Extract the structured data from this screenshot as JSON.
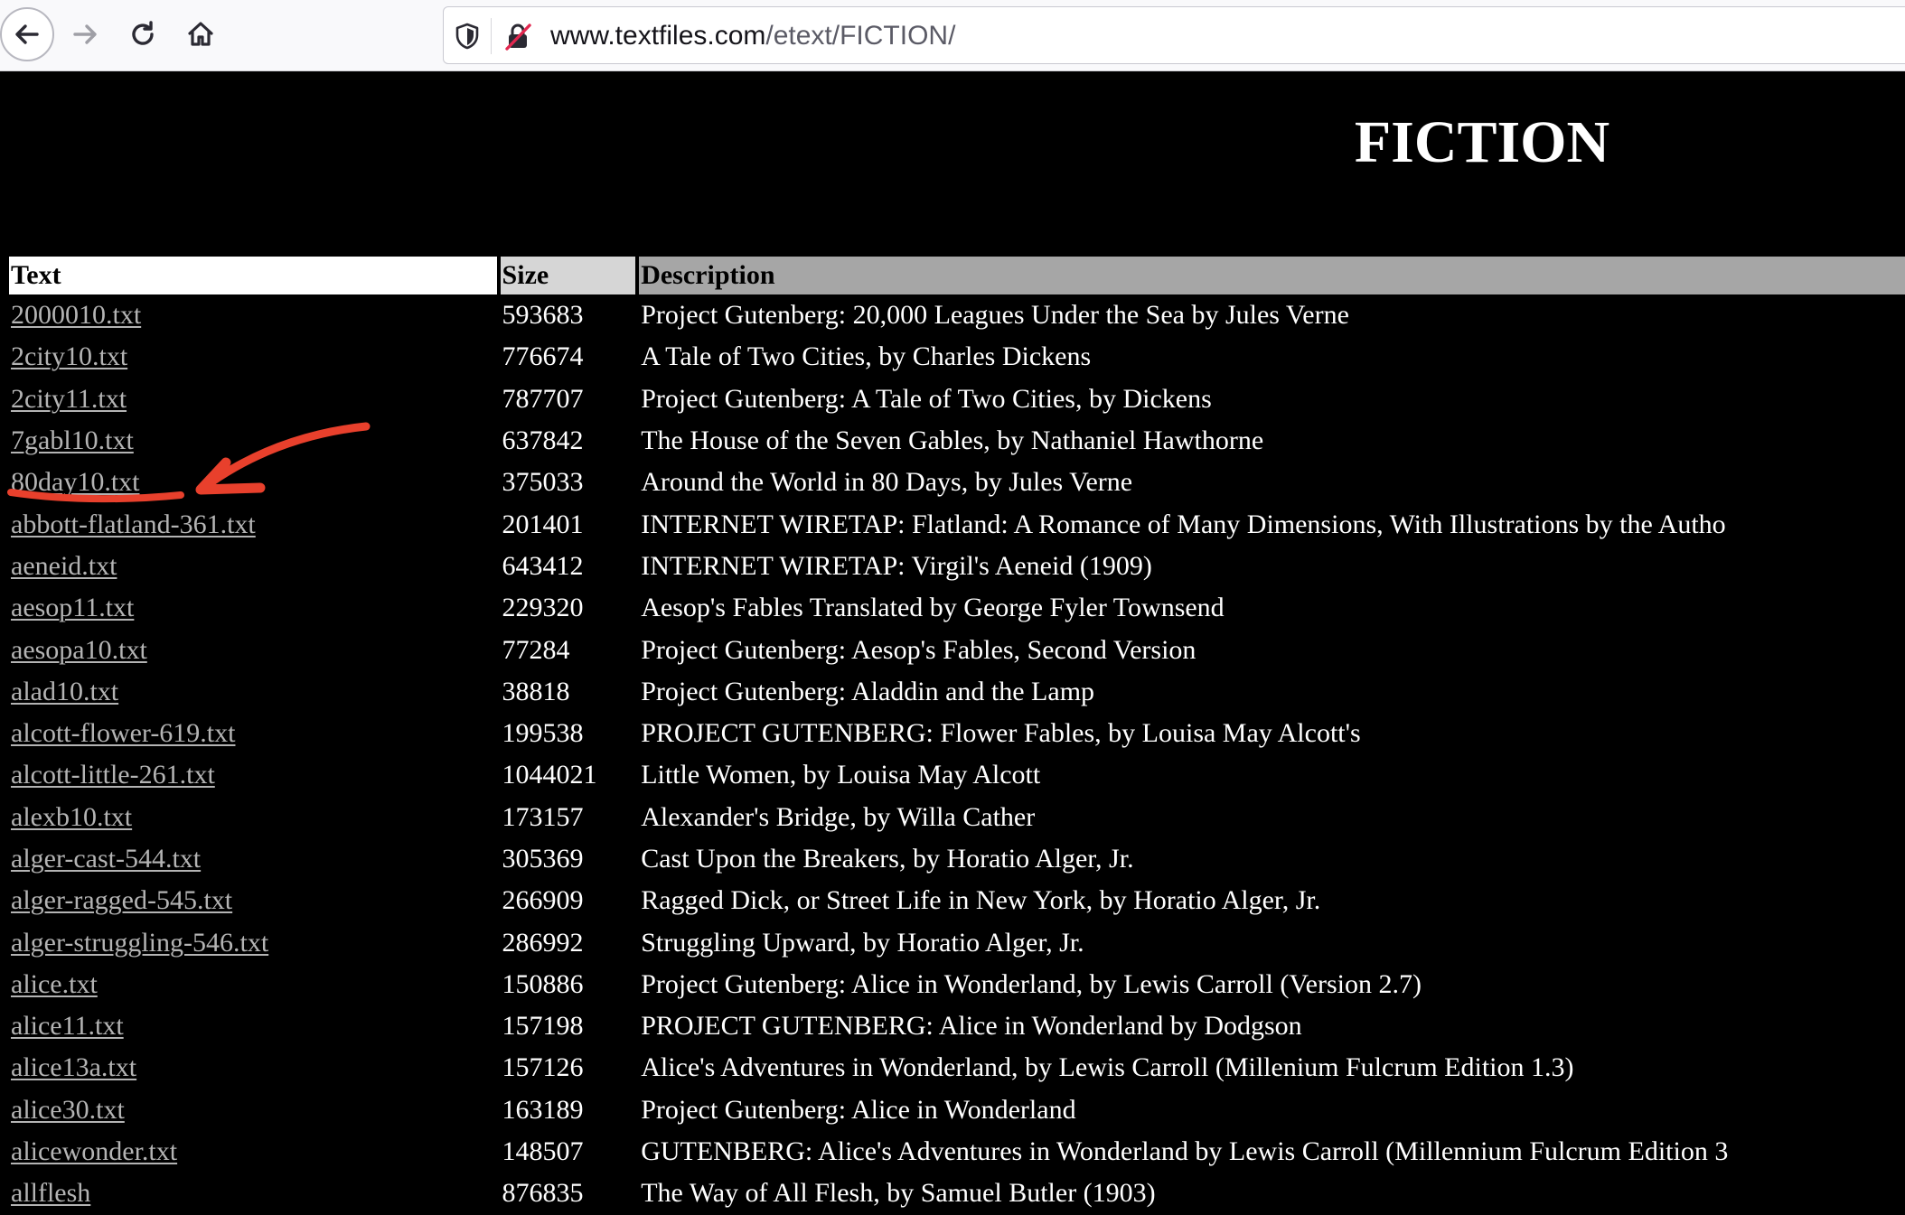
{
  "browser": {
    "back_icon": "arrow-left-icon",
    "forward_icon": "arrow-right-icon",
    "reload_icon": "reload-icon",
    "home_icon": "home-icon",
    "url_domain": "www.textfiles.com",
    "url_path": "/etext/FICTION/"
  },
  "page": {
    "title": "FICTION",
    "columns": {
      "text": "Text",
      "size": "Size",
      "description": "Description"
    },
    "rows": [
      {
        "file": "2000010.txt",
        "size": "593683",
        "desc": "Project Gutenberg: 20,000 Leagues Under the Sea by Jules Verne"
      },
      {
        "file": "2city10.txt",
        "size": "776674",
        "desc": "A Tale of Two Cities, by Charles Dickens"
      },
      {
        "file": "2city11.txt",
        "size": "787707",
        "desc": "Project Gutenberg: A Tale of Two Cities, by Dickens"
      },
      {
        "file": "7gabl10.txt",
        "size": "637842",
        "desc": "The House of the Seven Gables, by Nathaniel Hawthorne"
      },
      {
        "file": "80day10.txt",
        "size": "375033",
        "desc": "Around the World in 80 Days, by Jules Verne"
      },
      {
        "file": "abbott-flatland-361.txt",
        "size": "201401",
        "desc": "INTERNET WIRETAP: Flatland: A Romance of Many Dimensions, With Illustrations by the Autho"
      },
      {
        "file": "aeneid.txt",
        "size": "643412",
        "desc": "INTERNET WIRETAP: Virgil's Aeneid (1909)"
      },
      {
        "file": "aesop11.txt",
        "size": "229320",
        "desc": "Aesop's Fables Translated by George Fyler Townsend"
      },
      {
        "file": "aesopa10.txt",
        "size": "77284",
        "desc": "Project Gutenberg: Aesop's Fables, Second Version"
      },
      {
        "file": "alad10.txt",
        "size": "38818",
        "desc": "Project Gutenberg: Aladdin and the Lamp"
      },
      {
        "file": "alcott-flower-619.txt",
        "size": "199538",
        "desc": "PROJECT GUTENBERG: Flower Fables, by Louisa May Alcott's"
      },
      {
        "file": "alcott-little-261.txt",
        "size": "1044021",
        "desc": "Little Women, by Louisa May Alcott"
      },
      {
        "file": "alexb10.txt",
        "size": "173157",
        "desc": "Alexander's Bridge, by Willa Cather"
      },
      {
        "file": "alger-cast-544.txt",
        "size": "305369",
        "desc": "Cast Upon the Breakers, by Horatio Alger, Jr."
      },
      {
        "file": "alger-ragged-545.txt",
        "size": "266909",
        "desc": "Ragged Dick, or Street Life in New York, by Horatio Alger, Jr."
      },
      {
        "file": "alger-struggling-546.txt",
        "size": "286992",
        "desc": "Struggling Upward, by Horatio Alger, Jr."
      },
      {
        "file": "alice.txt",
        "size": "150886",
        "desc": "Project Gutenberg: Alice in Wonderland, by Lewis Carroll (Version 2.7)"
      },
      {
        "file": "alice11.txt",
        "size": "157198",
        "desc": "PROJECT GUTENBERG: Alice in Wonderland by Dodgson"
      },
      {
        "file": "alice13a.txt",
        "size": "157126",
        "desc": "Alice's Adventures in Wonderland, by Lewis Carroll (Millenium Fulcrum Edition 1.3)"
      },
      {
        "file": "alice30.txt",
        "size": "163189",
        "desc": "Project Gutenberg: Alice in Wonderland"
      },
      {
        "file": "alicewonder.txt",
        "size": "148507",
        "desc": "GUTENBERG: Alice's Adventures in Wonderland by Lewis Carroll (Millennium Fulcrum Edition 3"
      },
      {
        "file": "allflesh",
        "size": "876835",
        "desc": "The Way of All Flesh, by Samuel Butler (1903)"
      }
    ]
  },
  "annotation": {
    "type": "red-arrow",
    "color": "#e8402c",
    "points_to": "80day10.txt"
  }
}
